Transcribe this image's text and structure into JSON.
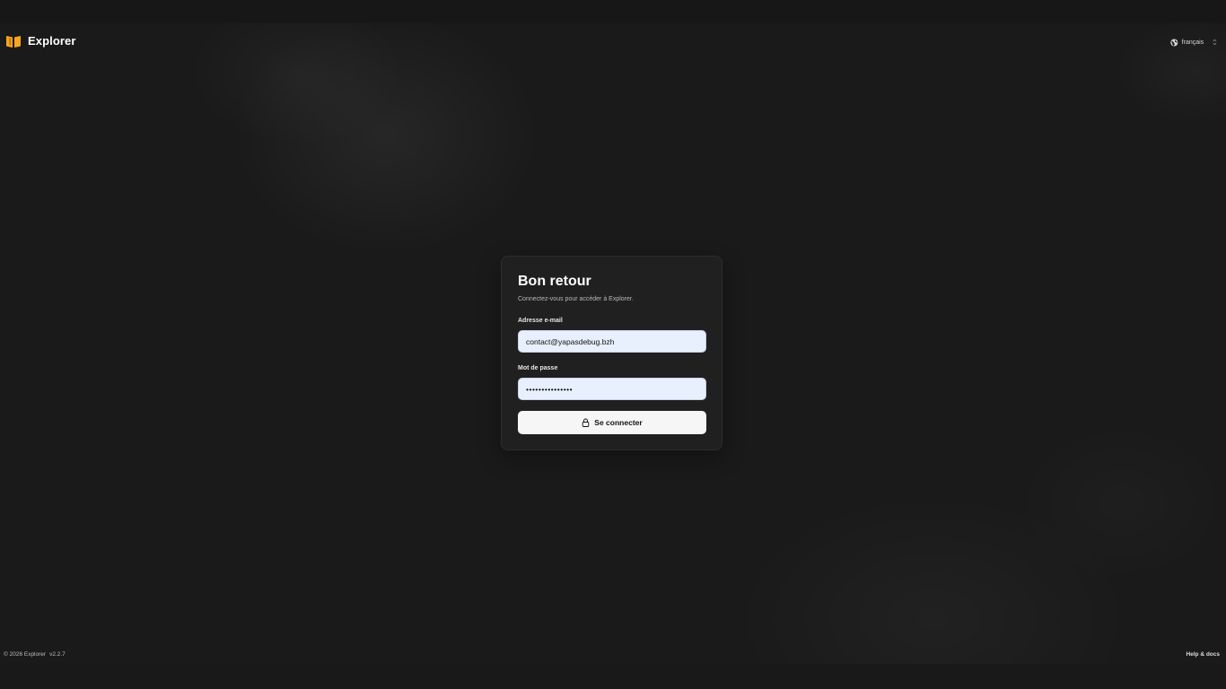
{
  "header": {
    "app_name": "Explorer",
    "logo_icon": "book-open-icon",
    "logo_color": "#f5a623",
    "language": {
      "icon": "globe-icon",
      "selected": "français"
    }
  },
  "login": {
    "title": "Bon retour",
    "subtitle": "Connectez-vous pour accéder à Explorer.",
    "email_label": "Adresse e-mail",
    "email_value": "contact@yapasdebug.bzh",
    "password_label": "Mot de passe",
    "password_value": "•••••••••••••••",
    "submit_label": "Se connecter",
    "submit_icon": "lock-icon"
  },
  "footer": {
    "copyright": "© 2026 Explorer",
    "version": "v2.2.7",
    "help_link": "Help & docs"
  }
}
